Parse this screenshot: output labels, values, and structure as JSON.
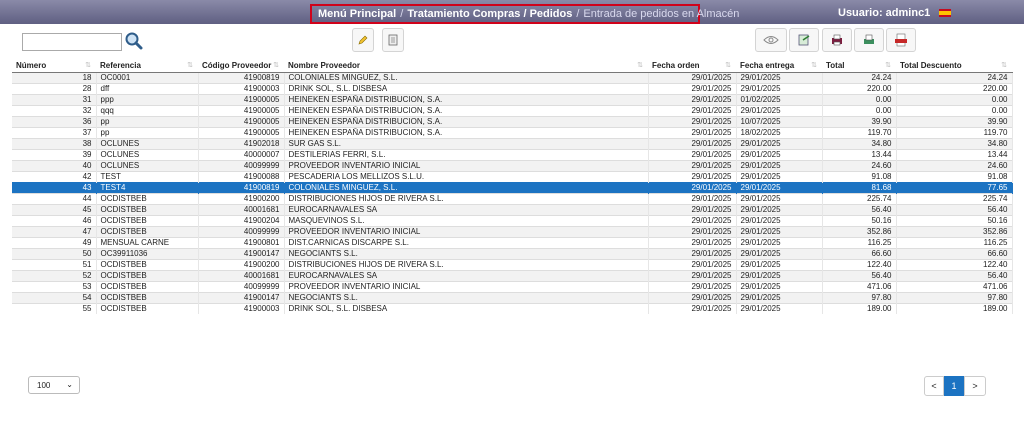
{
  "breadcrumb": {
    "home": "Menú Principal",
    "section": "Tratamiento Compras / Pedidos",
    "current": "Entrada de pedidos en Almacén",
    "separator": "/"
  },
  "user": {
    "label": "Usuario: adminc1"
  },
  "search": {
    "value": "",
    "placeholder": ""
  },
  "columns": [
    "Número",
    "Referencia",
    "Código Proveedor",
    "Nombre Proveedor",
    "Fecha orden",
    "Fecha entrega",
    "Total",
    "Total Descuento"
  ],
  "sort_glyph": "⇅",
  "rows": [
    [
      "18",
      "OC0001",
      "41900819",
      "COLONIALES MINGUEZ, S.L.",
      "29/01/2025",
      "29/01/2025",
      "24.24",
      "24.24"
    ],
    [
      "28",
      "dff",
      "41900003",
      "DRINK SOL, S.L. DISBESA",
      "29/01/2025",
      "29/01/2025",
      "220.00",
      "220.00"
    ],
    [
      "31",
      "ppp",
      "41900005",
      "HEINEKEN ESPAÑA DISTRIBUCION, S.A.",
      "29/01/2025",
      "01/02/2025",
      "0.00",
      "0.00"
    ],
    [
      "32",
      "qqq",
      "41900005",
      "HEINEKEN ESPAÑA DISTRIBUCION, S.A.",
      "29/01/2025",
      "29/01/2025",
      "0.00",
      "0.00"
    ],
    [
      "36",
      "pp",
      "41900005",
      "HEINEKEN ESPAÑA DISTRIBUCION, S.A.",
      "29/01/2025",
      "10/07/2025",
      "39.90",
      "39.90"
    ],
    [
      "37",
      "pp",
      "41900005",
      "HEINEKEN ESPAÑA DISTRIBUCION, S.A.",
      "29/01/2025",
      "18/02/2025",
      "119.70",
      "119.70"
    ],
    [
      "38",
      "OCLUNES",
      "41902018",
      "SUR GAS S.L.",
      "29/01/2025",
      "29/01/2025",
      "34.80",
      "34.80"
    ],
    [
      "39",
      "OCLUNES",
      "40000007",
      "DESTILERIAS FERRI, S.L.",
      "29/01/2025",
      "29/01/2025",
      "13.44",
      "13.44"
    ],
    [
      "40",
      "OCLUNES",
      "40099999",
      "PROVEEDOR INVENTARIO INICIAL",
      "29/01/2025",
      "29/01/2025",
      "24.60",
      "24.60"
    ],
    [
      "42",
      "TEST",
      "41900088",
      "PESCADERIA LOS MELLIZOS S.L.U.",
      "29/01/2025",
      "29/01/2025",
      "91.08",
      "91.08"
    ],
    [
      "43",
      "TEST4",
      "41900819",
      "COLONIALES MINGUEZ, S.L.",
      "29/01/2025",
      "29/01/2025",
      "81.68",
      "77.65"
    ],
    [
      "44",
      "OCDISTBEB",
      "41900200",
      "DISTRIBUCIONES HIJOS DE RIVERA S.L.",
      "29/01/2025",
      "29/01/2025",
      "225.74",
      "225.74"
    ],
    [
      "45",
      "OCDISTBEB",
      "40001681",
      "EUROCARNAVALES SA",
      "29/01/2025",
      "29/01/2025",
      "56.40",
      "56.40"
    ],
    [
      "46",
      "OCDISTBEB",
      "41900204",
      "MASQUEVINOS S.L.",
      "29/01/2025",
      "29/01/2025",
      "50.16",
      "50.16"
    ],
    [
      "47",
      "OCDISTBEB",
      "40099999",
      "PROVEEDOR INVENTARIO INICIAL",
      "29/01/2025",
      "29/01/2025",
      "352.86",
      "352.86"
    ],
    [
      "49",
      "MENSUAL CARNE",
      "41900801",
      "DIST.CARNICAS DISCARPE S.L.",
      "29/01/2025",
      "29/01/2025",
      "116.25",
      "116.25"
    ],
    [
      "50",
      "OC39911036",
      "41900147",
      "NEGOCIANTS S.L.",
      "29/01/2025",
      "29/01/2025",
      "66.60",
      "66.60"
    ],
    [
      "51",
      "OCDISTBEB",
      "41900200",
      "DISTRIBUCIONES HIJOS DE RIVERA S.L.",
      "29/01/2025",
      "29/01/2025",
      "122.40",
      "122.40"
    ],
    [
      "52",
      "OCDISTBEB",
      "40001681",
      "EUROCARNAVALES SA",
      "29/01/2025",
      "29/01/2025",
      "56.40",
      "56.40"
    ],
    [
      "53",
      "OCDISTBEB",
      "40099999",
      "PROVEEDOR INVENTARIO INICIAL",
      "29/01/2025",
      "29/01/2025",
      "471.06",
      "471.06"
    ],
    [
      "54",
      "OCDISTBEB",
      "41900147",
      "NEGOCIANTS S.L.",
      "29/01/2025",
      "29/01/2025",
      "97.80",
      "97.80"
    ],
    [
      "55",
      "OCDISTBEB",
      "41900003",
      "DRINK SOL, S.L. DISBESA",
      "29/01/2025",
      "29/01/2025",
      "189.00",
      "189.00"
    ]
  ],
  "selected_row": 10,
  "page_size": {
    "value": "100",
    "chevron": "⌄"
  },
  "pagination": {
    "prev": "<",
    "current": "1",
    "next": ">"
  },
  "colors": {
    "header_gradient_top": "#8a8aa8",
    "header_gradient_bottom": "#5f5f82",
    "highlight_border": "#d0021b",
    "selected_row": "#1c73c2",
    "pager_active": "#1c73c2"
  },
  "icons": [
    "search-icon",
    "edit-icon",
    "document-icon",
    "eye-icon",
    "export-icon",
    "print-icon",
    "fax-icon",
    "pdf-icon",
    "flag-icon"
  ]
}
